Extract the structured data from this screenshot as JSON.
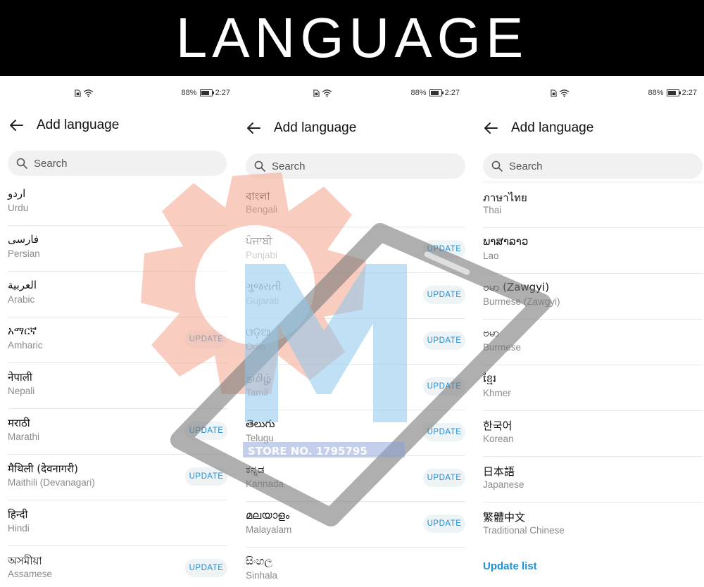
{
  "banner": {
    "title": "LANGUAGE"
  },
  "status": {
    "battery": "88%",
    "time": "2:27"
  },
  "header": {
    "title": "Add language"
  },
  "search": {
    "placeholder": "Search"
  },
  "update_label": "UPDATE",
  "panels": [
    {
      "items": [
        {
          "native": "اردو",
          "english": "Urdu",
          "update": false
        },
        {
          "native": "فارسی",
          "english": "Persian",
          "update": false
        },
        {
          "native": "العربية",
          "english": "Arabic",
          "update": false
        },
        {
          "native": "አማርኛ",
          "english": "Amharic",
          "update": true
        },
        {
          "native": "नेपाली",
          "english": "Nepali",
          "update": false
        },
        {
          "native": "मराठी",
          "english": "Marathi",
          "update": true
        },
        {
          "native": "मैथिली (देवनागरी)",
          "english": "Maithili (Devanagari)",
          "update": true
        },
        {
          "native": "हिन्दी",
          "english": "Hindi",
          "update": false
        },
        {
          "native": "অসমীয়া",
          "english": "Assamese",
          "update": true
        }
      ]
    },
    {
      "items": [
        {
          "native": "বাংলা",
          "english": "Bengali",
          "update": false
        },
        {
          "native": "ਪੰਜਾਬੀ",
          "english": "Punjabi",
          "update": true
        },
        {
          "native": "ગુજરાતી",
          "english": "Gujarati",
          "update": true
        },
        {
          "native": "ଓଡ଼ିଆ",
          "english": "Odia",
          "update": true
        },
        {
          "native": "தமிழ்",
          "english": "Tamil",
          "update": true
        },
        {
          "native": "తెలుగు",
          "english": "Telugu",
          "update": true
        },
        {
          "native": "ಕನ್ನಡ",
          "english": "Kannada",
          "update": true
        },
        {
          "native": "മലയാളം",
          "english": "Malayalam",
          "update": true
        },
        {
          "native": "සිංහල",
          "english": "Sinhala",
          "update": false
        }
      ]
    },
    {
      "items": [
        {
          "native": "ภาษาไทย",
          "english": "Thai",
          "update": false
        },
        {
          "native": "ພາສາລາວ",
          "english": "Lao",
          "update": false
        },
        {
          "native": "ဗမာ (Zawgyi)",
          "english": "Burmese (Zawgyi)",
          "update": false
        },
        {
          "native": "ဗမာ",
          "english": "Burmese",
          "update": false
        },
        {
          "native": "ខ្មែរ",
          "english": "Khmer",
          "update": false
        },
        {
          "native": "한국어",
          "english": "Korean",
          "update": false
        },
        {
          "native": "日本語",
          "english": "Japanese",
          "update": false
        },
        {
          "native": "繁體中文",
          "english": "Traditional Chinese",
          "update": false
        }
      ]
    }
  ],
  "footer": {
    "update_list": "Update list"
  },
  "watermark": {
    "text": "STORE NO. 1795795",
    "colors": {
      "gear": "#f4a58c",
      "logo": "#8cc6ec",
      "phone": "#7a7a7a"
    }
  }
}
